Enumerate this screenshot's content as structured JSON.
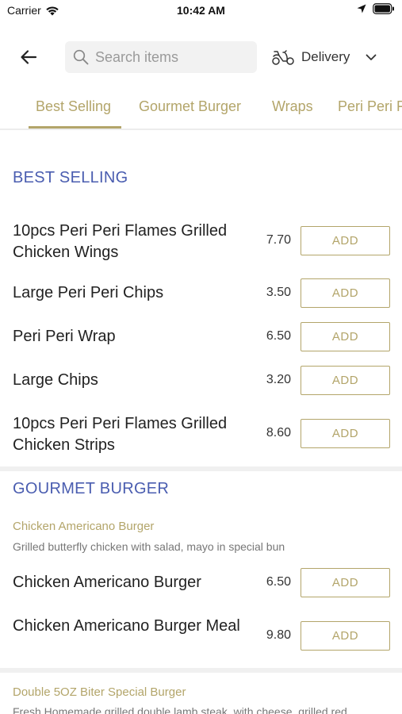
{
  "status_bar": {
    "carrier": "Carrier",
    "time": "10:42 AM"
  },
  "search": {
    "placeholder": "Search items"
  },
  "delivery": {
    "label": "Delivery"
  },
  "tabs": [
    {
      "label": "Best Selling",
      "active": true
    },
    {
      "label": "Gourmet Burger",
      "active": false
    },
    {
      "label": "Wraps",
      "active": false
    },
    {
      "label": "Peri Peri F",
      "active": false
    }
  ],
  "sections": {
    "best_selling": {
      "title": "BEST SELLING",
      "items": [
        {
          "name": "10pcs Peri Peri Flames Grilled Chicken Wings",
          "price": "7.70",
          "button": "ADD"
        },
        {
          "name": "Large Peri Peri Chips",
          "price": "3.50",
          "button": "ADD"
        },
        {
          "name": "Peri Peri Wrap",
          "price": "6.50",
          "button": "ADD"
        },
        {
          "name": "Large Chips",
          "price": "3.20",
          "button": "ADD"
        },
        {
          "name": "10pcs Peri Peri Flames Grilled Chicken Strips",
          "price": "8.60",
          "button": "ADD"
        }
      ]
    },
    "gourmet_burger": {
      "title": "GOURMET BURGER",
      "group1": {
        "title": "Chicken Americano Burger",
        "description": "Grilled butterfly chicken with salad, mayo in special bun",
        "items": [
          {
            "name": "Chicken Americano Burger",
            "price": "6.50",
            "button": "ADD"
          },
          {
            "name": "Chicken Americano Burger Meal",
            "price": "9.80",
            "button": "ADD"
          }
        ]
      },
      "group2": {
        "title": "Double 5OZ Biter Special Burger",
        "description": "Fresh Homemade grilled double lamb steak, with cheese, grilled red"
      }
    }
  },
  "colors": {
    "accent": "#b3a56a",
    "section_title": "#4a5db0",
    "divider": "#f0f0f0"
  }
}
